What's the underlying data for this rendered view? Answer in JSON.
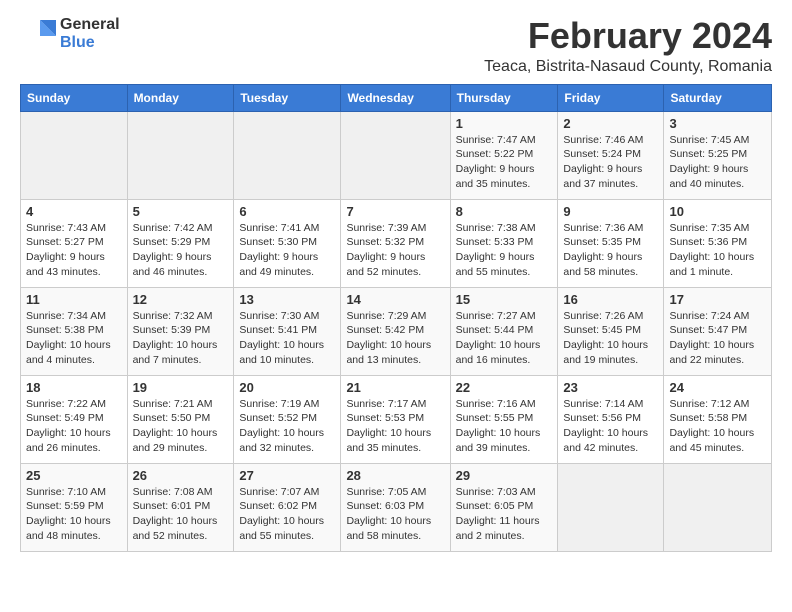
{
  "header": {
    "logo_general": "General",
    "logo_blue": "Blue",
    "month_title": "February 2024",
    "location": "Teaca, Bistrita-Nasaud County, Romania"
  },
  "weekdays": [
    "Sunday",
    "Monday",
    "Tuesday",
    "Wednesday",
    "Thursday",
    "Friday",
    "Saturday"
  ],
  "weeks": [
    [
      {
        "day": "",
        "info": ""
      },
      {
        "day": "",
        "info": ""
      },
      {
        "day": "",
        "info": ""
      },
      {
        "day": "",
        "info": ""
      },
      {
        "day": "1",
        "info": "Sunrise: 7:47 AM\nSunset: 5:22 PM\nDaylight: 9 hours\nand 35 minutes."
      },
      {
        "day": "2",
        "info": "Sunrise: 7:46 AM\nSunset: 5:24 PM\nDaylight: 9 hours\nand 37 minutes."
      },
      {
        "day": "3",
        "info": "Sunrise: 7:45 AM\nSunset: 5:25 PM\nDaylight: 9 hours\nand 40 minutes."
      }
    ],
    [
      {
        "day": "4",
        "info": "Sunrise: 7:43 AM\nSunset: 5:27 PM\nDaylight: 9 hours\nand 43 minutes."
      },
      {
        "day": "5",
        "info": "Sunrise: 7:42 AM\nSunset: 5:29 PM\nDaylight: 9 hours\nand 46 minutes."
      },
      {
        "day": "6",
        "info": "Sunrise: 7:41 AM\nSunset: 5:30 PM\nDaylight: 9 hours\nand 49 minutes."
      },
      {
        "day": "7",
        "info": "Sunrise: 7:39 AM\nSunset: 5:32 PM\nDaylight: 9 hours\nand 52 minutes."
      },
      {
        "day": "8",
        "info": "Sunrise: 7:38 AM\nSunset: 5:33 PM\nDaylight: 9 hours\nand 55 minutes."
      },
      {
        "day": "9",
        "info": "Sunrise: 7:36 AM\nSunset: 5:35 PM\nDaylight: 9 hours\nand 58 minutes."
      },
      {
        "day": "10",
        "info": "Sunrise: 7:35 AM\nSunset: 5:36 PM\nDaylight: 10 hours\nand 1 minute."
      }
    ],
    [
      {
        "day": "11",
        "info": "Sunrise: 7:34 AM\nSunset: 5:38 PM\nDaylight: 10 hours\nand 4 minutes."
      },
      {
        "day": "12",
        "info": "Sunrise: 7:32 AM\nSunset: 5:39 PM\nDaylight: 10 hours\nand 7 minutes."
      },
      {
        "day": "13",
        "info": "Sunrise: 7:30 AM\nSunset: 5:41 PM\nDaylight: 10 hours\nand 10 minutes."
      },
      {
        "day": "14",
        "info": "Sunrise: 7:29 AM\nSunset: 5:42 PM\nDaylight: 10 hours\nand 13 minutes."
      },
      {
        "day": "15",
        "info": "Sunrise: 7:27 AM\nSunset: 5:44 PM\nDaylight: 10 hours\nand 16 minutes."
      },
      {
        "day": "16",
        "info": "Sunrise: 7:26 AM\nSunset: 5:45 PM\nDaylight: 10 hours\nand 19 minutes."
      },
      {
        "day": "17",
        "info": "Sunrise: 7:24 AM\nSunset: 5:47 PM\nDaylight: 10 hours\nand 22 minutes."
      }
    ],
    [
      {
        "day": "18",
        "info": "Sunrise: 7:22 AM\nSunset: 5:49 PM\nDaylight: 10 hours\nand 26 minutes."
      },
      {
        "day": "19",
        "info": "Sunrise: 7:21 AM\nSunset: 5:50 PM\nDaylight: 10 hours\nand 29 minutes."
      },
      {
        "day": "20",
        "info": "Sunrise: 7:19 AM\nSunset: 5:52 PM\nDaylight: 10 hours\nand 32 minutes."
      },
      {
        "day": "21",
        "info": "Sunrise: 7:17 AM\nSunset: 5:53 PM\nDaylight: 10 hours\nand 35 minutes."
      },
      {
        "day": "22",
        "info": "Sunrise: 7:16 AM\nSunset: 5:55 PM\nDaylight: 10 hours\nand 39 minutes."
      },
      {
        "day": "23",
        "info": "Sunrise: 7:14 AM\nSunset: 5:56 PM\nDaylight: 10 hours\nand 42 minutes."
      },
      {
        "day": "24",
        "info": "Sunrise: 7:12 AM\nSunset: 5:58 PM\nDaylight: 10 hours\nand 45 minutes."
      }
    ],
    [
      {
        "day": "25",
        "info": "Sunrise: 7:10 AM\nSunset: 5:59 PM\nDaylight: 10 hours\nand 48 minutes."
      },
      {
        "day": "26",
        "info": "Sunrise: 7:08 AM\nSunset: 6:01 PM\nDaylight: 10 hours\nand 52 minutes."
      },
      {
        "day": "27",
        "info": "Sunrise: 7:07 AM\nSunset: 6:02 PM\nDaylight: 10 hours\nand 55 minutes."
      },
      {
        "day": "28",
        "info": "Sunrise: 7:05 AM\nSunset: 6:03 PM\nDaylight: 10 hours\nand 58 minutes."
      },
      {
        "day": "29",
        "info": "Sunrise: 7:03 AM\nSunset: 6:05 PM\nDaylight: 11 hours\nand 2 minutes."
      },
      {
        "day": "",
        "info": ""
      },
      {
        "day": "",
        "info": ""
      }
    ]
  ]
}
